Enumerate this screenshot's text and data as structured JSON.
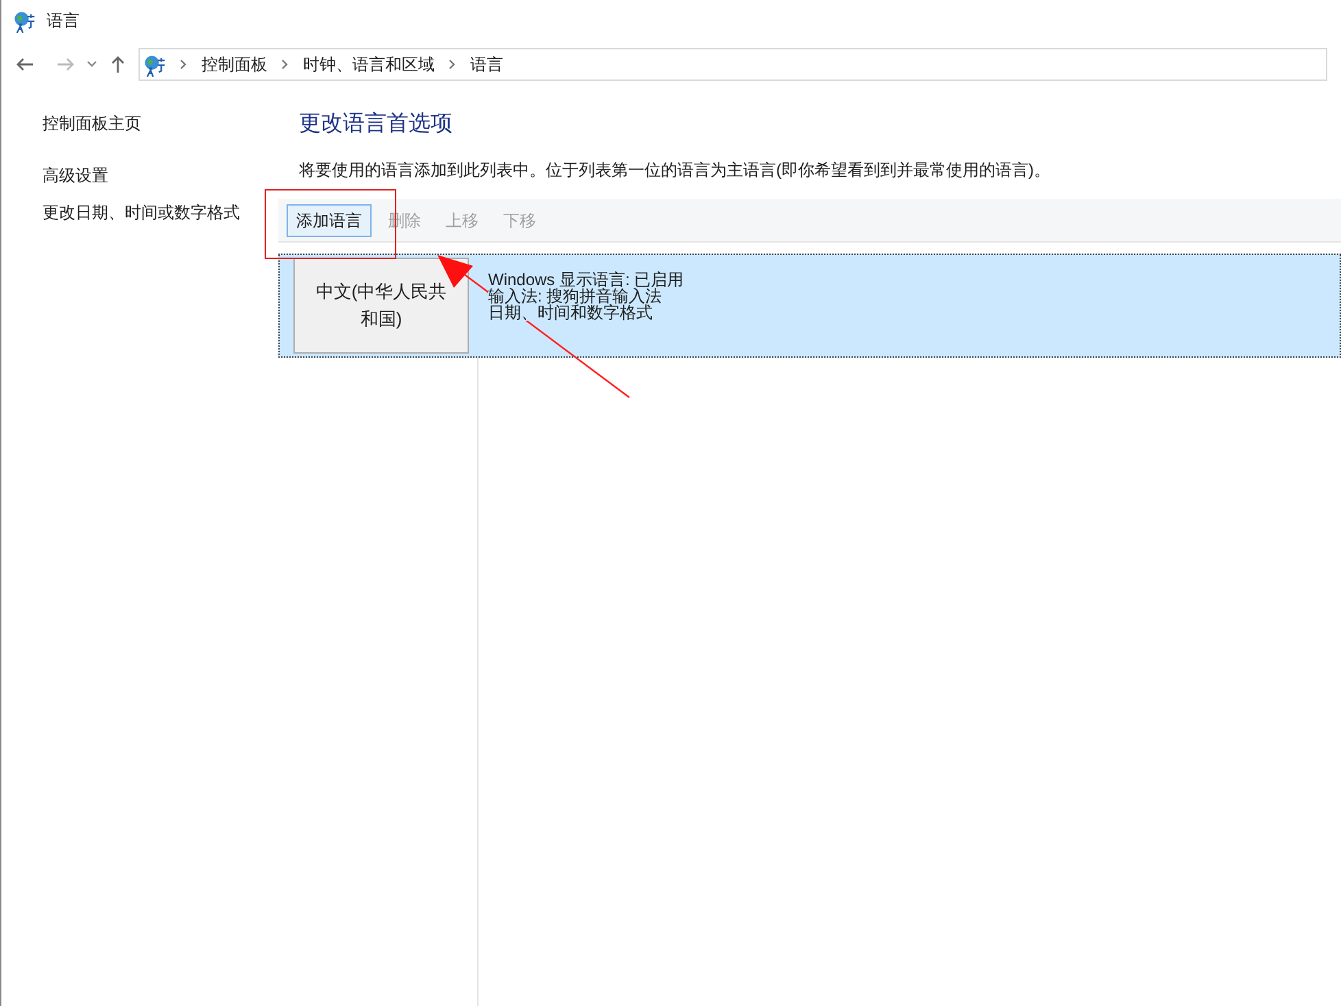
{
  "window": {
    "title": "语言"
  },
  "breadcrumb": [
    "控制面板",
    "时钟、语言和区域",
    "语言"
  ],
  "sidebar": {
    "items": [
      "控制面板主页",
      "高级设置",
      "更改日期、时间或数字格式"
    ]
  },
  "heading": "更改语言首选项",
  "description": "将要使用的语言添加到此列表中。位于列表第一位的语言为主语言(即你希望看到到并最常使用的语言)。",
  "toolbar": [
    {
      "label": "添加语言",
      "disabled": false
    },
    {
      "label": "删除",
      "disabled": true
    },
    {
      "label": "上移",
      "disabled": true
    },
    {
      "label": "下移",
      "disabled": true
    }
  ],
  "languages": [
    {
      "name": "中文(中华人民共和国)",
      "details": [
        "Windows 显示语言: 已启用",
        "输入法: 搜狗拼音输入法",
        "日期、时间和数字格式"
      ],
      "selected": true
    }
  ]
}
